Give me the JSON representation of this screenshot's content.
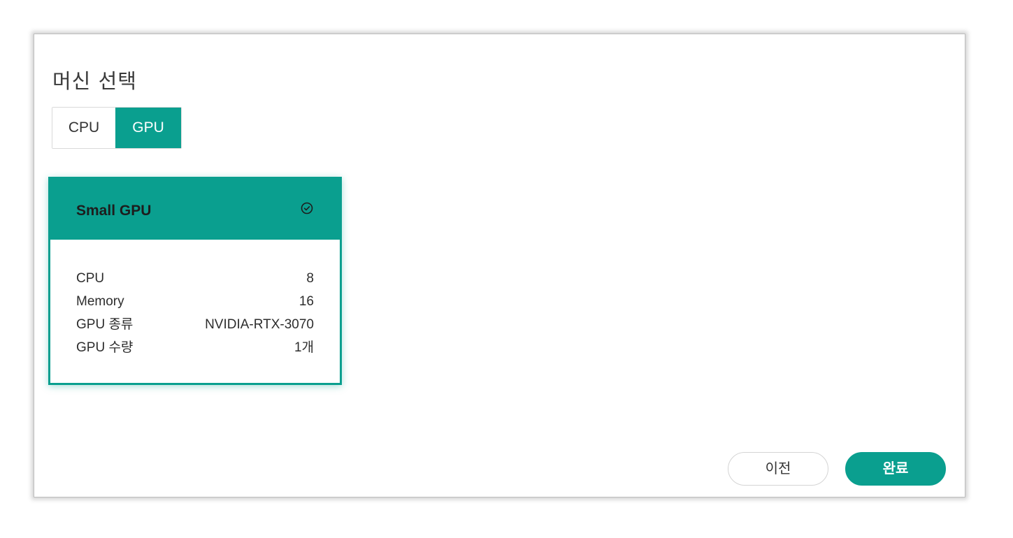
{
  "dialog": {
    "title": "머신 선택"
  },
  "machine_type": {
    "options": [
      {
        "label": "CPU",
        "selected": false
      },
      {
        "label": "GPU",
        "selected": true
      }
    ]
  },
  "machine_card": {
    "name": "Small GPU",
    "selected": true,
    "check_icon": "check-circle-icon",
    "specs": [
      {
        "label": "CPU",
        "value": "8"
      },
      {
        "label": "Memory",
        "value": "16"
      },
      {
        "label": "GPU 종류",
        "value": "NVIDIA-RTX-3070"
      },
      {
        "label": "GPU 수량",
        "value": "1개"
      }
    ]
  },
  "footer": {
    "prev_label": "이전",
    "done_label": "완료"
  },
  "colors": {
    "accent": "#0a9f8f",
    "border": "#d9d9d9"
  }
}
